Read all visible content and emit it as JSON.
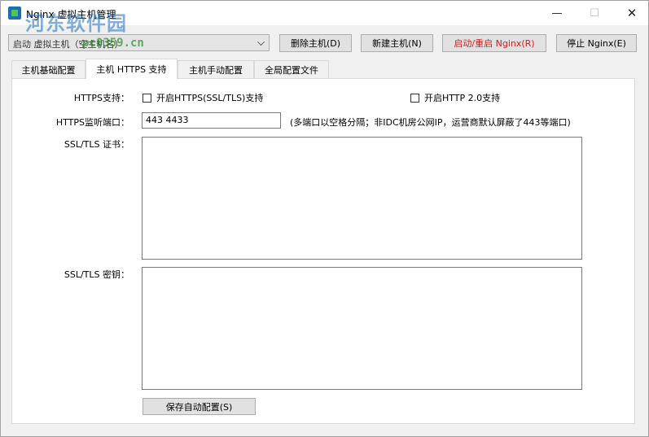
{
  "window": {
    "title": "Nginx 虚拟主机管理",
    "watermark": "河东软件园",
    "watermark_url": "pc0359.cn",
    "minimize_glyph": "—",
    "maximize_glyph": "☐",
    "close_glyph": "✕"
  },
  "host_selector": {
    "value": "启动 虚拟主机（空主机名）"
  },
  "toolbar": {
    "delete_host": "删除主机(D)",
    "new_host": "新建主机(N)",
    "restart_nginx": "启动/重启 Nginx(R)",
    "stop_nginx": "停止 Nginx(E)"
  },
  "tabs": [
    {
      "label": "主机基础配置"
    },
    {
      "label": "主机 HTTPS 支持"
    },
    {
      "label": "主机手动配置"
    },
    {
      "label": "全局配置文件"
    }
  ],
  "https": {
    "support_label": "HTTPS支持：",
    "enable_ssl_label": "开启HTTPS(SSL/TLS)支持",
    "enable_ssl_checked": false,
    "enable_http2_label": "开启HTTP 2.0支持",
    "enable_http2_checked": false,
    "port_label": "HTTPS监听端口：",
    "port_value": "443 4433",
    "port_hint": "(多端口以空格分隔；非IDC机房公网IP，运营商默认屏蔽了443等端口)",
    "cert_label": "SSL/TLS 证书：",
    "cert_value": "",
    "key_label": "SSL/TLS 密钥：",
    "key_value": "",
    "save_button": "保存自动配置(S)"
  }
}
